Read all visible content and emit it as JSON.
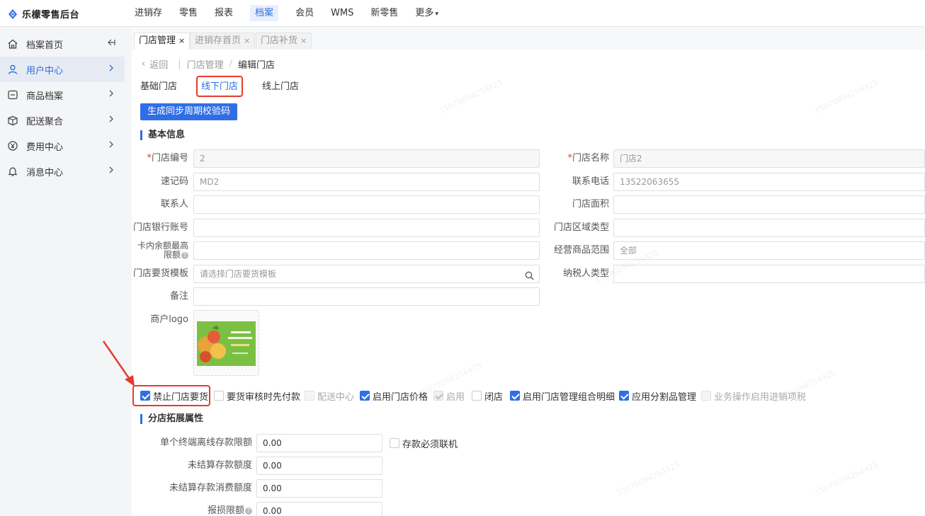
{
  "app": {
    "title": "乐檬零售后台",
    "brand_color": "#2f6ee6"
  },
  "topnav": [
    {
      "label": "进销存"
    },
    {
      "label": "零售"
    },
    {
      "label": "报表"
    },
    {
      "label": "档案",
      "active": true
    },
    {
      "label": "会员"
    },
    {
      "label": "WMS"
    },
    {
      "label": "新零售"
    },
    {
      "label": "更多"
    }
  ],
  "sidebar": {
    "items": [
      {
        "label": "档案首页",
        "icon": "home-icon"
      },
      {
        "label": "用户中心",
        "icon": "user-icon",
        "active": true
      },
      {
        "label": "商品档案",
        "icon": "product-icon"
      },
      {
        "label": "配送聚合",
        "icon": "delivery-icon"
      },
      {
        "label": "费用中心",
        "icon": "yuan-icon"
      },
      {
        "label": "消息中心",
        "icon": "bell-icon"
      }
    ]
  },
  "page_tabs": [
    {
      "label": "门店管理",
      "close": "×",
      "active": true
    },
    {
      "label": "进销存首页",
      "close": "×"
    },
    {
      "label": "门店补货",
      "close": "×"
    }
  ],
  "breadcrumb": {
    "back": "返回",
    "parent": "门店管理",
    "sep": "/",
    "current": "编辑门店"
  },
  "subtabs": [
    {
      "label": "基础门店"
    },
    {
      "label": "线下门店",
      "active": true
    },
    {
      "label": "线上门店"
    }
  ],
  "actions": {
    "generate_code": "生成同步周期校验码"
  },
  "basic_info": {
    "title": "基本信息",
    "store_code": {
      "label": "门店编号",
      "value": "2",
      "required": "*"
    },
    "store_name": {
      "label": "门店名称",
      "value": "门店2",
      "required": "*"
    },
    "quick_code": {
      "label": "速记码",
      "value": "MD2"
    },
    "phone": {
      "label": "联系电话",
      "value": "13522063655"
    },
    "contact": {
      "label": "联系人",
      "value": ""
    },
    "area": {
      "label": "门店面积",
      "value": ""
    },
    "bank_account": {
      "label": "门店银行账号",
      "value": ""
    },
    "region_type": {
      "label": "门店区域类型",
      "value": ""
    },
    "card_limit": {
      "label_line1": "卡内余额最高",
      "label_line2": "限额",
      "value": ""
    },
    "product_scope": {
      "label": "经营商品范围",
      "value": "全部"
    },
    "order_template": {
      "label": "门店要货模板",
      "placeholder": "请选择门店要货模板"
    },
    "taxpayer_type": {
      "label": "纳税人类型",
      "value": ""
    },
    "remark": {
      "label": "备注",
      "value": ""
    },
    "merchant_logo": {
      "label": "商户logo"
    }
  },
  "options": [
    {
      "label": "禁止门店要货",
      "state": "checked"
    },
    {
      "label": "要货审核时先付款",
      "state": "unchecked"
    },
    {
      "label": "配送中心",
      "state": "disabled"
    },
    {
      "label": "启用门店价格",
      "state": "checked"
    },
    {
      "label": "启用",
      "state": "disabled-checked"
    },
    {
      "label": "闭店",
      "state": "unchecked"
    },
    {
      "label": "启用门店管理组合明细",
      "state": "checked"
    },
    {
      "label": "应用分割品管理",
      "state": "checked"
    },
    {
      "label": "业务操作启用进销项税",
      "state": "disabled"
    }
  ],
  "extension": {
    "title": "分店拓展属性",
    "offline_limit": {
      "label": "单个终端离线存款限额",
      "value": "0.00"
    },
    "must_online": {
      "label": "存款必须联机"
    },
    "unsettled_amount": {
      "label": "未结算存款额度",
      "value": "0.00"
    },
    "unsettled_consume": {
      "label": "未结算存款消费额度",
      "value": "0.00"
    },
    "loss_limit": {
      "label": "报损限额",
      "value": "0.00"
    }
  },
  "annotation_color": "#e43c2c",
  "watermark": "15070094254425"
}
